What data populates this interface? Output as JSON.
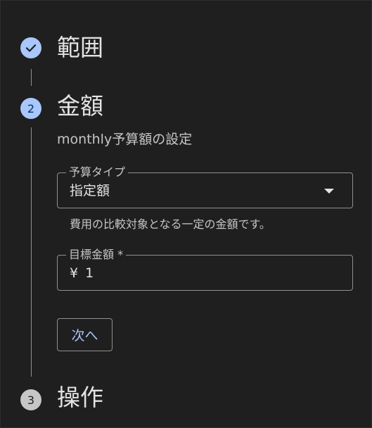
{
  "stepper": {
    "steps": [
      {
        "number": "1",
        "title": "範囲",
        "state": "completed"
      },
      {
        "number": "2",
        "title": "金額",
        "state": "active"
      },
      {
        "number": "3",
        "title": "操作",
        "state": "pending"
      }
    ],
    "active_step": {
      "subtitle": "monthly予算額の設定",
      "budget_type": {
        "label": "予算タイプ",
        "value": "指定額",
        "hint": "費用の比較対象となる一定の金額です。"
      },
      "target_amount": {
        "label": "目標金額 *",
        "currency": "¥",
        "value": "1"
      },
      "next_button": "次へ"
    }
  },
  "colors": {
    "background": "#1f1f1f",
    "accent": "#a8c7fa",
    "outline": "#8e918f",
    "text_primary": "#e3e3e3",
    "text_secondary": "#c4c7c5"
  }
}
